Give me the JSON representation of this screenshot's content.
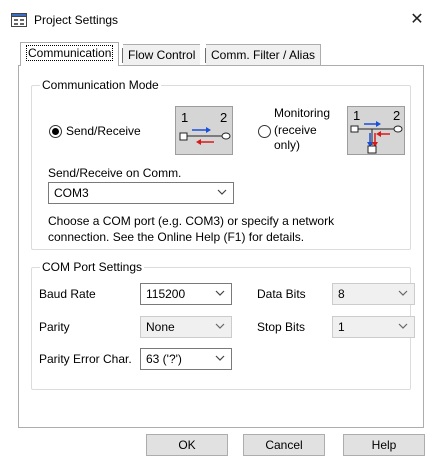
{
  "window": {
    "title": "Project Settings",
    "close_glyph": "✕",
    "icon": "settings-window-icon"
  },
  "tabs": [
    {
      "label": "Communication",
      "active": true
    },
    {
      "label": "Flow Control",
      "active": false
    },
    {
      "label": "Comm. Filter / Alias",
      "active": false
    }
  ],
  "communication_mode": {
    "title": "Communication Mode",
    "send_receive_label": "Send/Receive",
    "send_receive_selected": true,
    "monitoring_label_1": "Monitoring",
    "monitoring_label_2": "(receive",
    "monitoring_label_3": "only)",
    "diagram_send": {
      "left": "1",
      "right": "2"
    },
    "diagram_monitor": {
      "left": "1",
      "right": "2"
    },
    "port_label": "Send/Receive on Comm.",
    "port_value": "COM3",
    "help_line_1": "Choose a COM port (e.g. COM3) or specify a network",
    "help_line_2": "connection. See the Online Help (F1) for details."
  },
  "com_port_settings": {
    "title": "COM Port Settings",
    "baud_rate_label": "Baud Rate",
    "baud_rate_value": "115200",
    "data_bits_label": "Data Bits",
    "data_bits_value": "8",
    "parity_label": "Parity",
    "parity_value": "None",
    "stop_bits_label": "Stop Bits",
    "stop_bits_value": "1",
    "parity_error_label": "Parity Error Char.",
    "parity_error_value": "63 ('?')"
  },
  "buttons": {
    "ok": "OK",
    "cancel": "Cancel",
    "help": "Help"
  },
  "colors": {
    "arrow_blue": "#1a4fd8",
    "arrow_red": "#d81a1a",
    "diagram_bg": "#d5d5d5"
  }
}
